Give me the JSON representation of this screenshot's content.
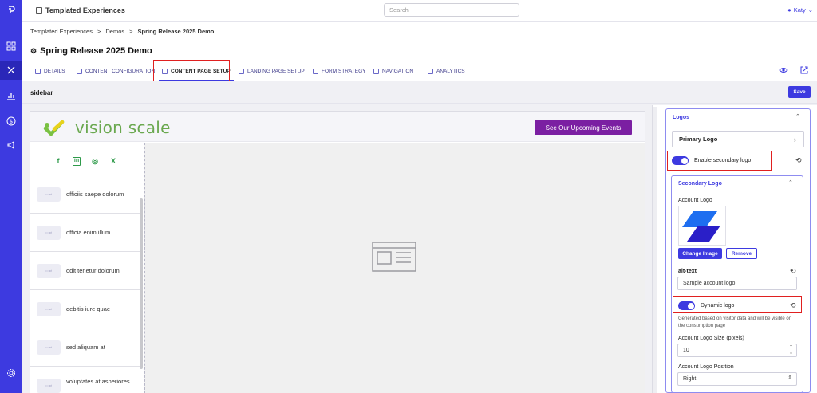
{
  "app": {
    "title": "Templated Experiences",
    "search_placeholder": "Search",
    "user": "Katy"
  },
  "rail": {
    "icons": [
      "logo-icon",
      "grid-icon",
      "experiences-icon",
      "analytics-icon",
      "dollar-icon",
      "megaphone-icon",
      "settings-icon"
    ]
  },
  "breadcrumb": {
    "items": [
      "Templated Experiences",
      "Demos"
    ],
    "current": "Spring Release 2025 Demo"
  },
  "page": {
    "title": "Spring Release 2025 Demo"
  },
  "tabs": [
    {
      "label": "Details"
    },
    {
      "label": "Content Configuration"
    },
    {
      "label": "Content Page Setup"
    },
    {
      "label": "Landing Page Setup"
    },
    {
      "label": "Form Strategy"
    },
    {
      "label": "Navigation"
    },
    {
      "label": "Analytics"
    }
  ],
  "subheader": {
    "label": "sidebar",
    "save": "Save"
  },
  "preview": {
    "brand": "vision scale",
    "cta": "See Our Upcoming Events",
    "social": [
      "f",
      "in",
      "◎",
      "X"
    ],
    "items": [
      "officiis saepe dolorum",
      "officia enim illum",
      "odit tenetur dolorum",
      "debitis iure quae",
      "sed aliquam at",
      "voluptates at asperiores"
    ]
  },
  "panel": {
    "section_title": "Logos",
    "primary_logo": "Primary Logo",
    "enable_secondary": "Enable secondary logo",
    "secondary_title": "Secondary Logo",
    "account_logo_label": "Account Logo",
    "change_image": "Change Image",
    "remove": "Remove",
    "alt_label": "alt-text",
    "alt_value": "Sample account logo",
    "dynamic_logo": "Dynamic logo",
    "dynamic_help": "Generated based on visitor data and will be visible on the consumption page",
    "size_label": "Account Logo Size (pixels)",
    "size_value": "10",
    "position_label": "Account Logo Position",
    "position_value": "Right"
  },
  "colors": {
    "accent": "#3d3ae0",
    "brand_green": "#6aa84f",
    "cta_purple": "#7b1fa2",
    "highlight": "#e02020"
  }
}
